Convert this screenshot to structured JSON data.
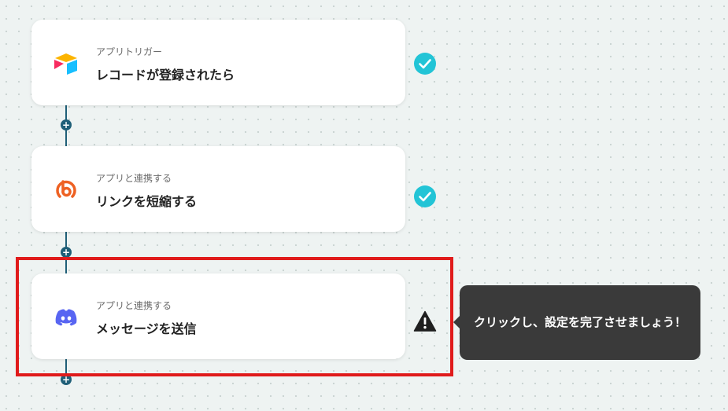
{
  "flow": {
    "steps": [
      {
        "subtitle": "アプリトリガー",
        "title": "レコードが登録されたら",
        "app_icon": "airtable-icon",
        "status": "completed"
      },
      {
        "subtitle": "アプリと連携する",
        "title": "リンクを短縮する",
        "app_icon": "bitly-icon",
        "status": "completed"
      },
      {
        "subtitle": "アプリと連携する",
        "title": "メッセージを送信",
        "app_icon": "discord-icon",
        "status": "warning"
      }
    ],
    "add_step_label": "+"
  },
  "tooltip": {
    "text": "クリックし、設定を完了させましょう！"
  },
  "colors": {
    "connector": "#1f5f78",
    "check": "#22c4d6",
    "warning": "#1f1f1f",
    "highlight": "#e01b1b",
    "tooltip_bg": "#3a3a3a",
    "discord": "#5865f2",
    "bitly": "#ee6123"
  }
}
